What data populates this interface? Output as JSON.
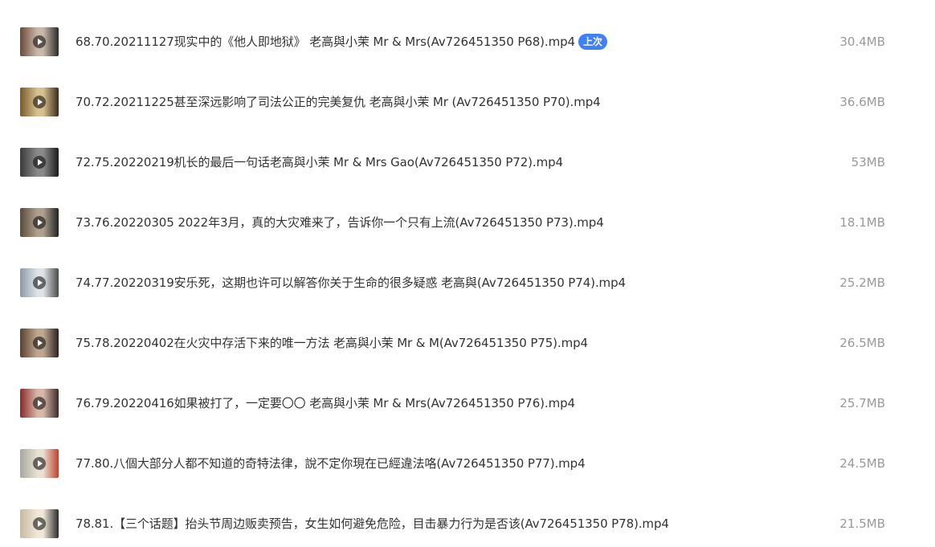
{
  "files": [
    {
      "name": "68.70.20211127现实中的《他人即地狱》 老高與小茉 Mr & Mrs(Av726451350 P68).mp4",
      "size": "30.4MB",
      "badge": "上次",
      "thumb_colors": [
        "#6b4a3a",
        "#c9b8a8",
        "#2a2a2a"
      ]
    },
    {
      "name": "70.72.20211225甚至深远影响了司法公正的完美复仇 老高與小茉 Mr (Av726451350 P70).mp4",
      "size": "36.6MB",
      "thumb_colors": [
        "#7a5a2a",
        "#d8c090",
        "#3a2a1a"
      ]
    },
    {
      "name": "72.75.20220219机长的最后一句话老高與小茉 Mr & Mrs Gao(Av726451350 P72).mp4",
      "size": "53MB",
      "thumb_colors": [
        "#3a3a3a",
        "#8a8a8a",
        "#1a1a1a"
      ]
    },
    {
      "name": "73.76.20220305 2022年3月，真的大灾难来了，告诉你一个只有上流(Av726451350 P73).mp4",
      "size": "18.1MB",
      "thumb_colors": [
        "#5a4a3a",
        "#b0a090",
        "#222222"
      ]
    },
    {
      "name": "74.77.20220319安乐死，这期也许可以解答你关于生命的很多疑惑 老高與(Av726451350 P74).mp4",
      "size": "25.2MB",
      "thumb_colors": [
        "#8a9aa8",
        "#dfe4e8",
        "#4a4a4a"
      ]
    },
    {
      "name": "75.78.20220402在火灾中存活下来的唯一方法 老高與小茉 Mr & M(Av726451350 P75).mp4",
      "size": "26.5MB",
      "thumb_colors": [
        "#5a4030",
        "#c0a890",
        "#2a2020"
      ]
    },
    {
      "name": "76.79.20220416如果被打了，一定要〇〇 老高與小茉 Mr & Mrs(Av726451350 P76).mp4",
      "size": "25.7MB",
      "thumb_colors": [
        "#8a2a2a",
        "#d8b8a8",
        "#3a2a2a"
      ]
    },
    {
      "name": "77.80.八個大部分人都不知道的奇特法律，說不定你現在已經違法咯(Av726451350 P77).mp4",
      "size": "24.5MB",
      "thumb_colors": [
        "#a8a8a0",
        "#e8e0d0",
        "#c04030"
      ]
    },
    {
      "name": "78.81.【三个话题】抬头节周边贩卖预告，女生如何避免危险，目击暴力行为是否该(Av726451350 P78).mp4",
      "size": "21.5MB",
      "thumb_colors": [
        "#c8b8a0",
        "#f0e8d8",
        "#2a2a2a"
      ]
    }
  ]
}
